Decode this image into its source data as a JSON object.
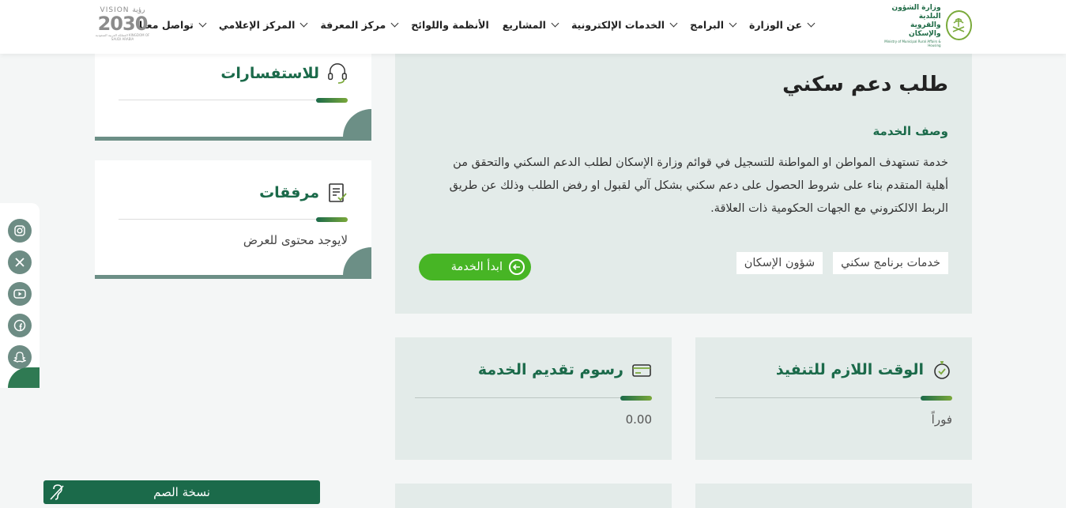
{
  "header": {
    "logo": {
      "name": "وزارة الشؤون البلدية والقروية والإسكان",
      "line1": "وزارة الشؤون البلدية",
      "line2": "والقروية والإسكان",
      "english": "Ministry of Municipal Rural Affairs & Housing"
    },
    "vision": {
      "top": "VISION رؤية",
      "year": "2030",
      "bottom": "المملكة العربية السعودية KINGDOM OF SAUDI ARABIA"
    },
    "nav": [
      {
        "label": "عن الوزارة",
        "has_dropdown": true
      },
      {
        "label": "البرامج",
        "has_dropdown": true
      },
      {
        "label": "الخدمات الإلكترونية",
        "has_dropdown": true
      },
      {
        "label": "المشاريع",
        "has_dropdown": true
      },
      {
        "label": "الأنظمة واللوائح",
        "has_dropdown": false
      },
      {
        "label": "مركز المعرفة",
        "has_dropdown": true
      },
      {
        "label": "المركز الإعلامي",
        "has_dropdown": true
      },
      {
        "label": "تواصل معنا",
        "has_dropdown": true
      }
    ]
  },
  "service": {
    "title": "طلب دعم سكني",
    "description_heading": "وصف الخدمة",
    "description": "خدمة تستهدف المواطن او المواطنة للتسجيل في قوائم وزارة الإسكان لطلب الدعم السكني والتحقق من أهلية المتقدم بناء على شروط الحصول على دعم سكني بشكل آلي لقبول او رفض الطلب وذلك عن طريق الربط الالكتروني مع الجهات الحكومية ذات العلاقة.",
    "tags": [
      "خدمات برنامج سكني",
      "شؤون الإسكان"
    ],
    "start_button": "ابدأ الخدمة"
  },
  "info_cards": {
    "time": {
      "title": "الوقت اللازم للتنفيذ",
      "value": "فوراً",
      "icon": "stopwatch-icon"
    },
    "fees": {
      "title": "رسوم تقديم الخدمة",
      "value": "0.00",
      "icon": "credit-card-icon"
    }
  },
  "sidebar": {
    "inquiries": {
      "title": "للاستفسارات",
      "icon": "headset-icon"
    },
    "attachments": {
      "title": "مرفقات",
      "empty_text": "لايوجد محتوى للعرض",
      "icon": "document-check-icon"
    }
  },
  "social": [
    "instagram-icon",
    "x-icon",
    "youtube-icon",
    "facebook-icon",
    "snapchat-icon"
  ],
  "deaf_version": {
    "label": "نسخة الصم",
    "icon": "deaf-ear-icon"
  },
  "colors": {
    "primary_green": "#1b6a4a",
    "accent_green": "#47b525",
    "card_bg": "#e3ebe9",
    "gray_green": "#6c8f86"
  }
}
